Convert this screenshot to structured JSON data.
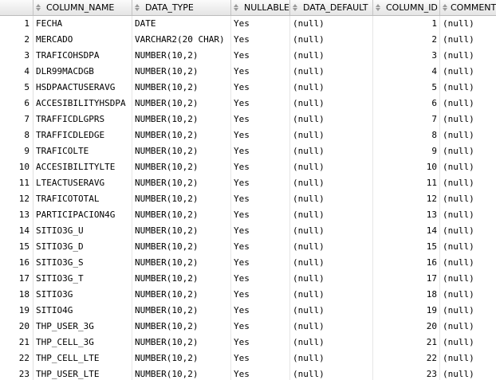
{
  "columns": [
    "COLUMN_NAME",
    "DATA_TYPE",
    "NULLABLE",
    "DATA_DEFAULT",
    "COLUMN_ID",
    "COMMENTS"
  ],
  "rows": [
    {
      "n": "1",
      "name": "FECHA",
      "type": "DATE",
      "nullable": "Yes",
      "default": "(null)",
      "id": "1",
      "comments": "(null)"
    },
    {
      "n": "2",
      "name": "MERCADO",
      "type": "VARCHAR2(20 CHAR)",
      "nullable": "Yes",
      "default": "(null)",
      "id": "2",
      "comments": "(null)"
    },
    {
      "n": "3",
      "name": "TRAFICOHSDPA",
      "type": "NUMBER(10,2)",
      "nullable": "Yes",
      "default": "(null)",
      "id": "3",
      "comments": "(null)"
    },
    {
      "n": "4",
      "name": "DLR99MACDGB",
      "type": "NUMBER(10,2)",
      "nullable": "Yes",
      "default": "(null)",
      "id": "4",
      "comments": "(null)"
    },
    {
      "n": "5",
      "name": "HSDPAACTUSERAVG",
      "type": "NUMBER(10,2)",
      "nullable": "Yes",
      "default": "(null)",
      "id": "5",
      "comments": "(null)"
    },
    {
      "n": "6",
      "name": "ACCESIBILITYHSDPA",
      "type": "NUMBER(10,2)",
      "nullable": "Yes",
      "default": "(null)",
      "id": "6",
      "comments": "(null)"
    },
    {
      "n": "7",
      "name": "TRAFFICDLGPRS",
      "type": "NUMBER(10,2)",
      "nullable": "Yes",
      "default": "(null)",
      "id": "7",
      "comments": "(null)"
    },
    {
      "n": "8",
      "name": "TRAFFICDLEDGE",
      "type": "NUMBER(10,2)",
      "nullable": "Yes",
      "default": "(null)",
      "id": "8",
      "comments": "(null)"
    },
    {
      "n": "9",
      "name": "TRAFICOLTE",
      "type": "NUMBER(10,2)",
      "nullable": "Yes",
      "default": "(null)",
      "id": "9",
      "comments": "(null)"
    },
    {
      "n": "10",
      "name": "ACCESIBILITYLTE",
      "type": "NUMBER(10,2)",
      "nullable": "Yes",
      "default": "(null)",
      "id": "10",
      "comments": "(null)"
    },
    {
      "n": "11",
      "name": "LTEACTUSERAVG",
      "type": "NUMBER(10,2)",
      "nullable": "Yes",
      "default": "(null)",
      "id": "11",
      "comments": "(null)"
    },
    {
      "n": "12",
      "name": "TRAFICOTOTAL",
      "type": "NUMBER(10,2)",
      "nullable": "Yes",
      "default": "(null)",
      "id": "12",
      "comments": "(null)"
    },
    {
      "n": "13",
      "name": "PARTICIPACION4G",
      "type": "NUMBER(10,2)",
      "nullable": "Yes",
      "default": "(null)",
      "id": "13",
      "comments": "(null)"
    },
    {
      "n": "14",
      "name": "SITIO3G_U",
      "type": "NUMBER(10,2)",
      "nullable": "Yes",
      "default": "(null)",
      "id": "14",
      "comments": "(null)"
    },
    {
      "n": "15",
      "name": "SITIO3G_D",
      "type": "NUMBER(10,2)",
      "nullable": "Yes",
      "default": "(null)",
      "id": "15",
      "comments": "(null)"
    },
    {
      "n": "16",
      "name": "SITIO3G_S",
      "type": "NUMBER(10,2)",
      "nullable": "Yes",
      "default": "(null)",
      "id": "16",
      "comments": "(null)"
    },
    {
      "n": "17",
      "name": "SITIO3G_T",
      "type": "NUMBER(10,2)",
      "nullable": "Yes",
      "default": "(null)",
      "id": "17",
      "comments": "(null)"
    },
    {
      "n": "18",
      "name": "SITIO3G",
      "type": "NUMBER(10,2)",
      "nullable": "Yes",
      "default": "(null)",
      "id": "18",
      "comments": "(null)"
    },
    {
      "n": "19",
      "name": "SITIO4G",
      "type": "NUMBER(10,2)",
      "nullable": "Yes",
      "default": "(null)",
      "id": "19",
      "comments": "(null)"
    },
    {
      "n": "20",
      "name": "THP_USER_3G",
      "type": "NUMBER(10,2)",
      "nullable": "Yes",
      "default": "(null)",
      "id": "20",
      "comments": "(null)"
    },
    {
      "n": "21",
      "name": "THP_CELL_3G",
      "type": "NUMBER(10,2)",
      "nullable": "Yes",
      "default": "(null)",
      "id": "21",
      "comments": "(null)"
    },
    {
      "n": "22",
      "name": "THP_CELL_LTE",
      "type": "NUMBER(10,2)",
      "nullable": "Yes",
      "default": "(null)",
      "id": "22",
      "comments": "(null)"
    },
    {
      "n": "23",
      "name": "THP_USER_LTE",
      "type": "NUMBER(10,2)",
      "nullable": "Yes",
      "default": "(null)",
      "id": "23",
      "comments": "(null)"
    }
  ]
}
